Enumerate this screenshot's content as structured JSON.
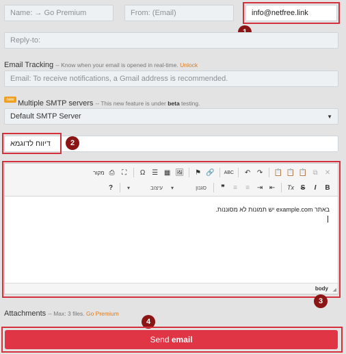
{
  "fields": {
    "name_placeholder": "Name: → Go Premium",
    "from_placeholder": "From: (Email)",
    "from_value": "info@netfree.link",
    "replyto_placeholder": "Reply-to:"
  },
  "tracking": {
    "label": "Email Tracking",
    "note": "-- Know when your email is opened in real-time.",
    "unlock_link": "Unlock",
    "input_placeholder": "Email: To receive notifications, a Gmail address is recommended."
  },
  "smtp": {
    "new_badge": "new",
    "label": "Multiple SMTP servers",
    "note_prefix": "-- This new feature is under",
    "note_bold": "beta",
    "note_suffix": "testing.",
    "selected": "Default SMTP Server"
  },
  "subject": {
    "value": "דיווח לדוגמא"
  },
  "editor": {
    "toolbar_row1": [
      "✕",
      "⧉",
      "📋",
      "📋",
      "📋",
      "↷",
      "↶",
      "ABC",
      "🔗",
      "⚑",
      "🖼",
      "▦",
      "☰",
      "Ω",
      "⛶",
      "⎙",
      "מקור"
    ],
    "toolbar_row2": [
      "B",
      "I",
      "S",
      "Tx",
      "⇤",
      "⇥",
      "≡",
      "≡",
      "❞"
    ],
    "format_combo": "סגנון",
    "font_combo": "עיצוב",
    "help": "?",
    "body_text": "באתר example.com יש תמונות לא מסוננות.",
    "status_path": "body"
  },
  "attachments": {
    "label": "Attachments",
    "note": "-- Max: 3 files.",
    "link": "Go Premium"
  },
  "send": {
    "label_plain": "Send",
    "label_bold": "email"
  },
  "badges": [
    "1",
    "2",
    "3",
    "4"
  ],
  "colors": {
    "accent_red": "#df3545",
    "badge": "#8b1414",
    "link_orange": "#e07a1b"
  }
}
